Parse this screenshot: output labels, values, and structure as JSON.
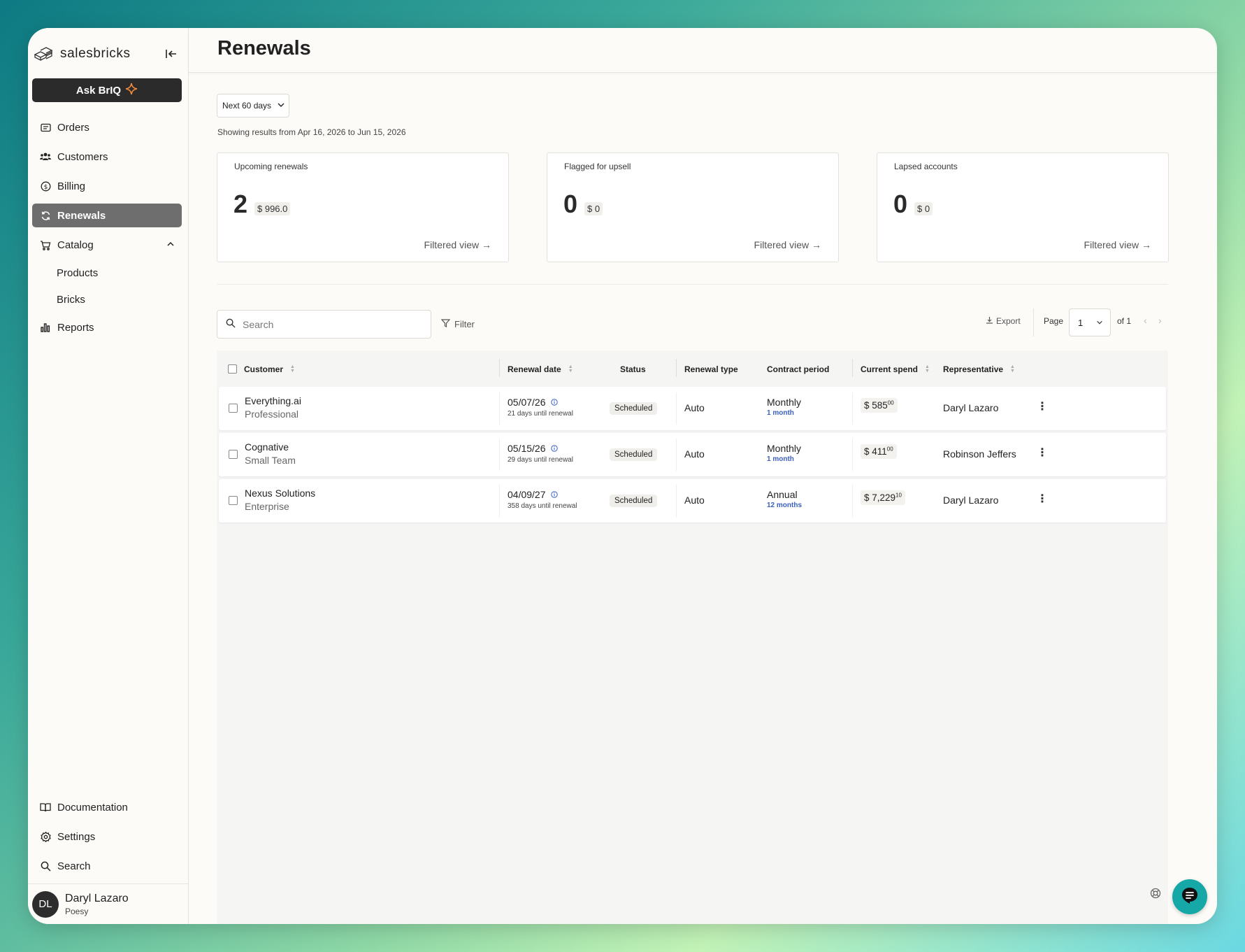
{
  "brand": {
    "name": "salesbricks"
  },
  "sidebar": {
    "ask_label": "Ask BrIQ",
    "items": [
      {
        "label": "Orders",
        "icon": "orders-icon"
      },
      {
        "label": "Customers",
        "icon": "customers-icon"
      },
      {
        "label": "Billing",
        "icon": "billing-icon"
      },
      {
        "label": "Renewals",
        "icon": "renewals-icon",
        "active": true
      },
      {
        "label": "Catalog",
        "icon": "catalog-icon",
        "expanded": true
      },
      {
        "label": "Reports",
        "icon": "reports-icon"
      }
    ],
    "catalog_children": [
      "Products",
      "Bricks"
    ],
    "bottom": [
      {
        "label": "Documentation",
        "icon": "book-icon"
      },
      {
        "label": "Settings",
        "icon": "gear-icon"
      },
      {
        "label": "Search",
        "icon": "search-icon"
      }
    ],
    "user": {
      "initials": "DL",
      "name": "Daryl Lazaro",
      "org": "Poesy"
    }
  },
  "page": {
    "title": "Renewals",
    "range_select": "Next 60 days",
    "range_info": "Showing results from Apr 16, 2026 to Jun 15, 2026"
  },
  "stats": [
    {
      "label": "Upcoming renewals",
      "count": "2",
      "amount": "$ 996.0",
      "link": "Filtered view →"
    },
    {
      "label": "Flagged for upsell",
      "count": "0",
      "amount": "$ 0",
      "link": "Filtered view →"
    },
    {
      "label": "Lapsed accounts",
      "count": "0",
      "amount": "$ 0",
      "link": "Filtered view →"
    }
  ],
  "toolbar": {
    "search_placeholder": "Search",
    "filter_label": "Filter",
    "export_label": "Export",
    "page_label": "Page",
    "page_value": "1",
    "page_of": "of 1"
  },
  "table": {
    "headers": {
      "customer": "Customer",
      "renewal_date": "Renewal date",
      "status": "Status",
      "renewal_type": "Renewal type",
      "contract_period": "Contract period",
      "current_spend": "Current spend",
      "representative": "Representative"
    },
    "rows": [
      {
        "customer": "Everything.ai",
        "plan": "Professional",
        "date": "05/07/26",
        "days": "21 days until renewal",
        "status": "Scheduled",
        "type": "Auto",
        "period": "Monthly",
        "period_sub": "1 month",
        "spend_whole": "$ 585",
        "spend_cents": "00",
        "rep": "Daryl Lazaro"
      },
      {
        "customer": "Cognative",
        "plan": "Small Team",
        "date": "05/15/26",
        "days": "29 days until renewal",
        "status": "Scheduled",
        "type": "Auto",
        "period": "Monthly",
        "period_sub": "1 month",
        "spend_whole": "$ 411",
        "spend_cents": "00",
        "rep": "Robinson Jeffers"
      },
      {
        "customer": "Nexus Solutions",
        "plan": "Enterprise",
        "date": "04/09/27",
        "days": "358 days until renewal",
        "status": "Scheduled",
        "type": "Auto",
        "period": "Annual",
        "period_sub": "12 months",
        "spend_whole": "$ 7,229",
        "spend_cents": "10",
        "rep": "Daryl Lazaro"
      }
    ]
  },
  "colors": {
    "active_nav": "#6e6e6e",
    "ask_button": "#2b2b2b",
    "chat_button": "#16a8a6",
    "link_blue": "#3a5fbf"
  }
}
